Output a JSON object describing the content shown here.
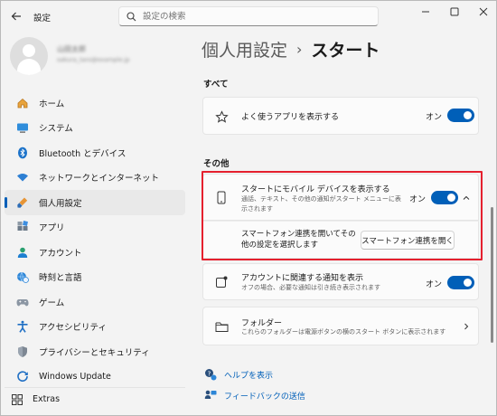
{
  "window": {
    "app_title": "設定",
    "icons": {
      "back": "back-arrow-icon",
      "minimize": "minimize-icon",
      "maximize": "maximize-icon",
      "close": "close-icon"
    }
  },
  "search": {
    "placeholder": "設定の検索",
    "value": "",
    "icon": "search-icon"
  },
  "profile": {
    "name": "山田太郎",
    "email": "sakura_taro@example.jp"
  },
  "sidebar": {
    "items": [
      {
        "label": "ホーム",
        "icon": "home-icon",
        "active": false
      },
      {
        "label": "システム",
        "icon": "system-display-icon",
        "active": false
      },
      {
        "label": "Bluetooth とデバイス",
        "icon": "bluetooth-icon",
        "active": false
      },
      {
        "label": "ネットワークとインターネット",
        "icon": "wifi-icon",
        "active": false
      },
      {
        "label": "個人用設定",
        "icon": "paintbrush-icon",
        "active": true
      },
      {
        "label": "アプリ",
        "icon": "apps-icon",
        "active": false
      },
      {
        "label": "アカウント",
        "icon": "account-icon",
        "active": false
      },
      {
        "label": "時刻と言語",
        "icon": "globe-clock-icon",
        "active": false
      },
      {
        "label": "ゲーム",
        "icon": "gamepad-icon",
        "active": false
      },
      {
        "label": "アクセシビリティ",
        "icon": "accessibility-icon",
        "active": false
      },
      {
        "label": "プライバシーとセキュリティ",
        "icon": "shield-icon",
        "active": false
      },
      {
        "label": "Windows Update",
        "icon": "windows-update-icon",
        "active": false
      }
    ],
    "extras": {
      "label": "Extras",
      "icon": "extras-grid-icon"
    }
  },
  "breadcrumb": {
    "parent": "個人用設定",
    "separator": "›",
    "current": "スタート"
  },
  "sections": {
    "all": {
      "title": "すべて",
      "row": {
        "title": "よく使うアプリを表示する",
        "state": "オン",
        "toggle_on": true,
        "icon": "star-icon"
      }
    },
    "other": {
      "title": "その他",
      "mobile": {
        "title": "スタートにモバイル デバイスを表示する",
        "desc_line1": "通話、テキスト、その他の通知がスタート メニューに表",
        "desc_line2": "示されます",
        "state": "オン",
        "toggle_on": true,
        "icon": "phone-icon",
        "expanded": true
      },
      "mobile_sub": {
        "text_line1": "スマートフォン連携を開いてその",
        "text_line2": "他の設定を選択します",
        "button": "スマートフォン連携を開く"
      },
      "account_notify": {
        "title": "アカウントに関連する通知を表示",
        "desc": "オフの場合、必要な通知は引き続き表示されます",
        "state": "オン",
        "toggle_on": true,
        "icon": "notification-app-icon"
      },
      "folders": {
        "title": "フォルダー",
        "desc": "これらのフォルダーは電源ボタンの横のスタート ボタンに表示されます",
        "icon": "folder-icon"
      }
    }
  },
  "links": {
    "help": {
      "label": "ヘルプを表示",
      "icon": "help-icon"
    },
    "feedback": {
      "label": "フィードバックの送信",
      "icon": "feedback-icon"
    }
  },
  "colors": {
    "accent": "#005fb8",
    "highlight": "#e5202e",
    "background": "#f3f3f3",
    "card": "#fbfbfb"
  }
}
